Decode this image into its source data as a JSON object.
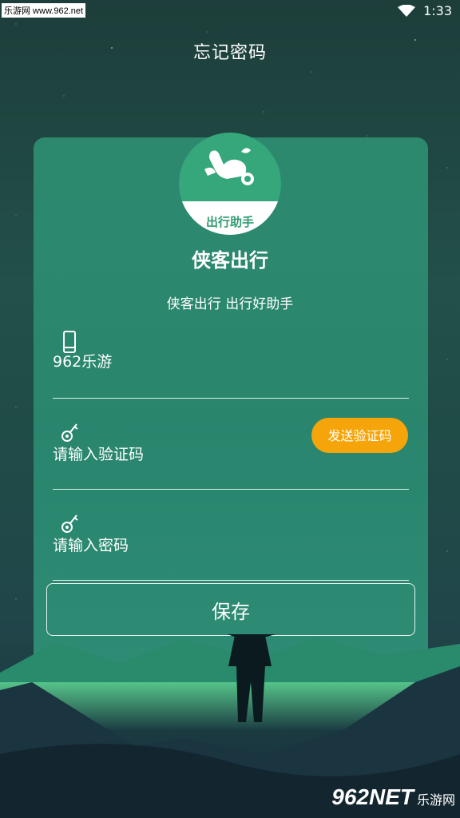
{
  "status_bar": {
    "watermark": "乐游网 www.962.net",
    "time": "1:33",
    "wifi_icon": "wifi-icon"
  },
  "header": {
    "title": "忘记密码"
  },
  "app": {
    "logo_text": "出行助手",
    "name": "侠客出行",
    "slogan": "侠客出行 出行好助手"
  },
  "form": {
    "phone_value": "962乐游",
    "phone_icon": "phone-icon",
    "code_placeholder": "请输入验证码",
    "code_icon": "key-icon",
    "send_code_label": "发送验证码",
    "password_placeholder": "请输入密码",
    "password_icon": "key-icon",
    "save_label": "保存"
  },
  "watermark_bottom": {
    "main": "962NET",
    "sub": "乐游网"
  },
  "colors": {
    "accent": "#f5a50a",
    "card": "#2e8f72",
    "logo": "#35a77a"
  }
}
